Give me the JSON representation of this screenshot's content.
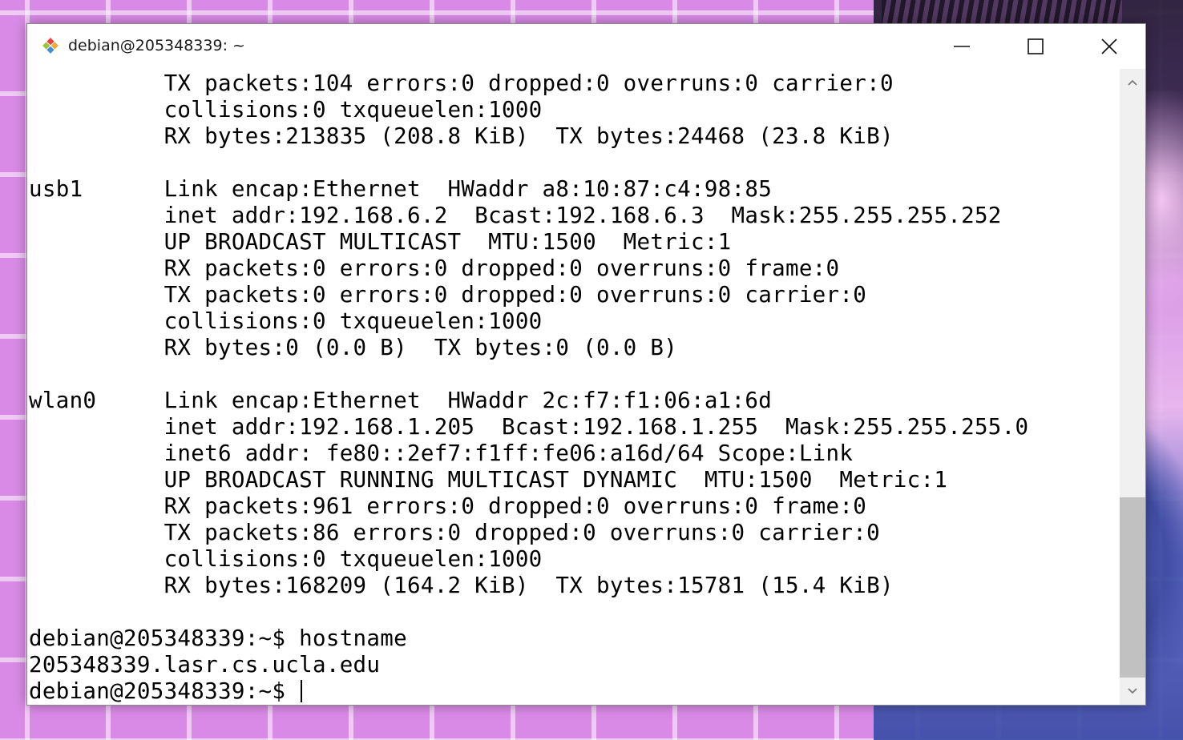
{
  "window": {
    "title": "debian@205348339: ~",
    "icon": "git-bash-icon",
    "controls": {
      "minimize": "minimize-icon",
      "maximize": "maximize-icon",
      "close": "close-icon"
    }
  },
  "terminal": {
    "lines": [
      "          TX packets:104 errors:0 dropped:0 overruns:0 carrier:0",
      "          collisions:0 txqueuelen:1000",
      "          RX bytes:213835 (208.8 KiB)  TX bytes:24468 (23.8 KiB)",
      "",
      "usb1      Link encap:Ethernet  HWaddr a8:10:87:c4:98:85",
      "          inet addr:192.168.6.2  Bcast:192.168.6.3  Mask:255.255.255.252",
      "          UP BROADCAST MULTICAST  MTU:1500  Metric:1",
      "          RX packets:0 errors:0 dropped:0 overruns:0 frame:0",
      "          TX packets:0 errors:0 dropped:0 overruns:0 carrier:0",
      "          collisions:0 txqueuelen:1000",
      "          RX bytes:0 (0.0 B)  TX bytes:0 (0.0 B)",
      "",
      "wlan0     Link encap:Ethernet  HWaddr 2c:f7:f1:06:a1:6d",
      "          inet addr:192.168.1.205  Bcast:192.168.1.255  Mask:255.255.255.0",
      "          inet6 addr: fe80::2ef7:f1ff:fe06:a16d/64 Scope:Link",
      "          UP BROADCAST RUNNING MULTICAST DYNAMIC  MTU:1500  Metric:1",
      "          RX packets:961 errors:0 dropped:0 overruns:0 frame:0",
      "          TX packets:86 errors:0 dropped:0 overruns:0 carrier:0",
      "          collisions:0 txqueuelen:1000",
      "          RX bytes:168209 (164.2 KiB)  TX bytes:15781 (15.4 KiB)",
      "",
      "debian@205348339:~$ hostname",
      "205348339.lasr.cs.ucla.edu"
    ],
    "prompt": "debian@205348339:~$ "
  },
  "scrollbar": {
    "up_icon": "chevron-up-icon",
    "down_icon": "chevron-down-icon",
    "position": 0.92
  },
  "colors": {
    "terminal_bg": "#ffffff",
    "terminal_fg": "#000000",
    "desktop_bg": "#d98ae6"
  }
}
